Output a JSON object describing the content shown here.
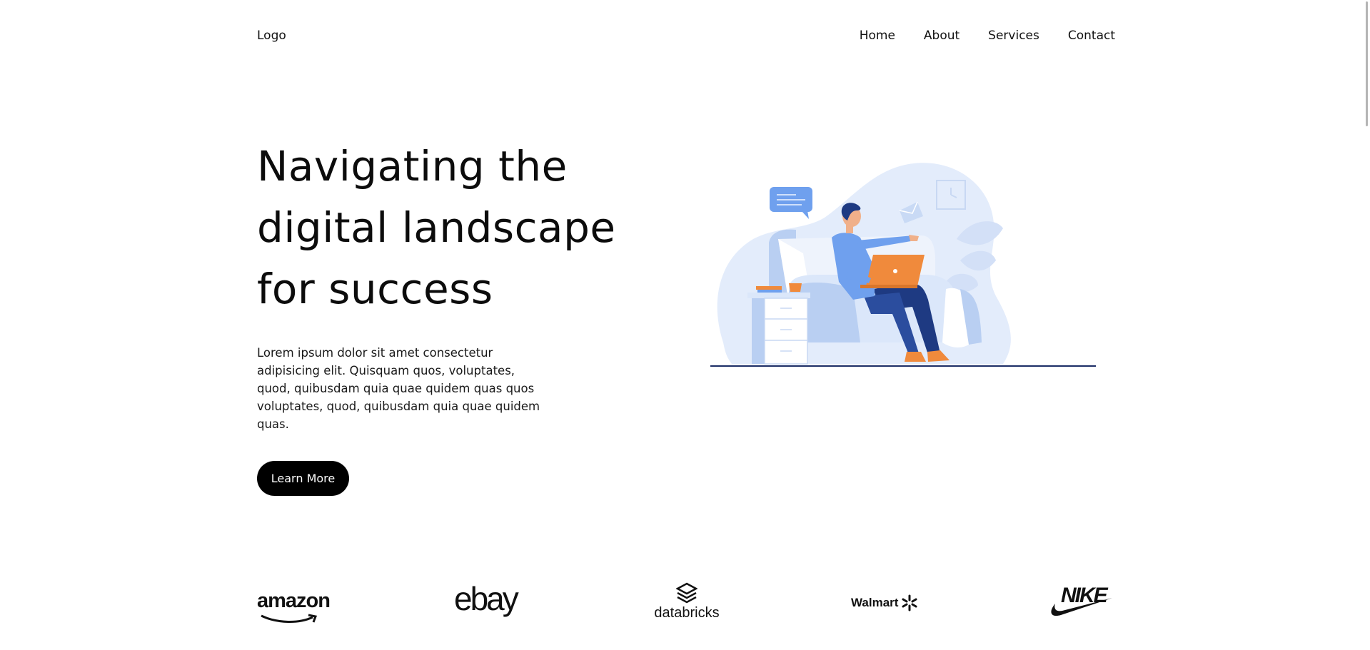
{
  "header": {
    "logo": "Logo",
    "nav": [
      "Home",
      "About",
      "Services",
      "Contact"
    ]
  },
  "hero": {
    "title_lines": [
      "Navigating the",
      "digital landscape",
      "for success"
    ],
    "description": "Lorem ipsum dolor sit amet consectetur adipisicing elit. Quisquam quos, voluptates, quod, quibusdam quia quae quidem quas quos voluptates, quod, quibusdam quia quae quidem quas.",
    "button": "Learn More"
  },
  "brands": [
    "amazon",
    "ebay",
    "databricks",
    "Walmart",
    "NIKE"
  ],
  "colors": {
    "accent_blue": "#6fa0ee",
    "light_blue": "#e3ecfb",
    "orange": "#f08a3c",
    "dark_navy": "#25408f",
    "button": "#000000"
  },
  "illustration": {
    "name": "person-on-couch-with-laptop",
    "icons": [
      "speech-bubble-icon",
      "clock-icon",
      "envelope-icon",
      "laptop-icon",
      "plant-icon"
    ]
  }
}
